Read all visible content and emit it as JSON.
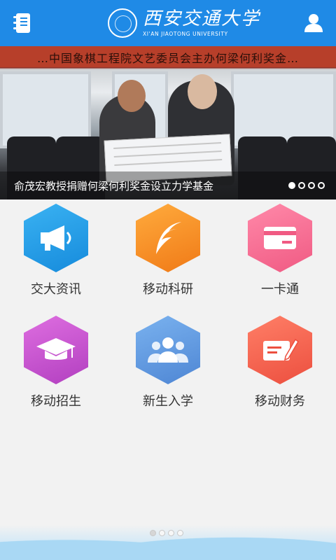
{
  "header": {
    "app_title_cn": "西安交通大学",
    "app_title_en": "XI'AN JIAOTONG UNIVERSITY",
    "menu_icon": "notebook-icon",
    "user_icon": "user-icon",
    "color": "#1f8ae6"
  },
  "banner": {
    "caption": "俞茂宏教授捐赠何梁何利奖金设立力学基金",
    "cloth_text": "…中国象棋工程院文艺委员会主办何梁何利奖金…",
    "slides": 4,
    "active_slide": 1
  },
  "tiles": [
    {
      "label": "交大资讯",
      "icon": "megaphone-icon"
    },
    {
      "label": "移动科研",
      "icon": "quill-icon"
    },
    {
      "label": "一卡通",
      "icon": "card-icon"
    },
    {
      "label": "移动招生",
      "icon": "graduation-cap-icon"
    },
    {
      "label": "新生入学",
      "icon": "people-icon"
    },
    {
      "label": "移动财务",
      "icon": "ledger-pen-icon"
    }
  ],
  "pager": {
    "pages": 4,
    "active": 1
  }
}
